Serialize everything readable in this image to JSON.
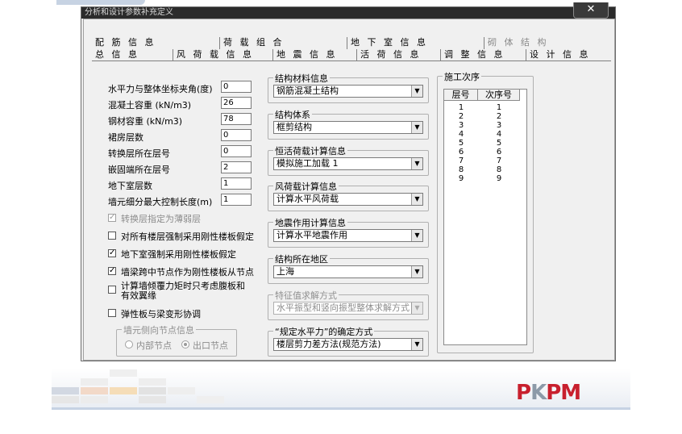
{
  "window": {
    "title": "分析和设计参数补充定义",
    "close_glyph": "✕"
  },
  "tabs": {
    "row1": [
      {
        "label": "配 筋 信 息",
        "enabled": true
      },
      {
        "label": "荷 载 组 合",
        "enabled": true
      },
      {
        "label": "地 下 室 信 息",
        "enabled": true
      },
      {
        "label": "砌 体 结 构",
        "enabled": false
      }
    ],
    "row2": [
      {
        "label": "总 信 息",
        "active": true
      },
      {
        "label": "风 荷 载 信 息"
      },
      {
        "label": "地 震 信 息"
      },
      {
        "label": "活 荷 信 息"
      },
      {
        "label": "调 整 信 息"
      },
      {
        "label": "设 计 信 息"
      }
    ]
  },
  "fields": [
    {
      "label": "水平力与整体坐标夹角(度)",
      "value": "0"
    },
    {
      "label": "混凝土容重  (kN/m3)",
      "value": "26"
    },
    {
      "label": "钢材容重     (kN/m3)",
      "value": "78"
    },
    {
      "label": "裙房层数",
      "value": "0"
    },
    {
      "label": "转换层所在层号",
      "value": "0"
    },
    {
      "label": "嵌固端所在层号",
      "value": "2"
    },
    {
      "label": "地下室层数",
      "value": "1"
    },
    {
      "label": "墙元细分最大控制长度(m)",
      "value": "1"
    }
  ],
  "checkboxes": [
    {
      "label": "转换层指定为薄弱层",
      "checked": true,
      "enabled": false
    },
    {
      "label": "对所有楼层强制采用刚性楼板假定",
      "checked": false,
      "enabled": true
    },
    {
      "label": "地下室强制采用刚性楼板假定",
      "checked": true,
      "enabled": true
    },
    {
      "label": "墙梁跨中节点作为刚性楼板从节点",
      "checked": true,
      "enabled": true
    },
    {
      "label": "计算墙倾覆力矩时只考虑腹板和",
      "label2": "有效翼缘",
      "checked": false,
      "enabled": true
    },
    {
      "label": "弹性板与梁变形协调",
      "checked": false,
      "enabled": true
    }
  ],
  "wall_node_group": {
    "title": "墙元侧向节点信息",
    "options": [
      "内部节点",
      "出口节点"
    ],
    "selected": "出口节点"
  },
  "dropdown_groups": [
    {
      "title": "结构材料信息",
      "value": "钢筋混凝土结构",
      "enabled": true
    },
    {
      "title": "结构体系",
      "value": "框剪结构",
      "enabled": true
    },
    {
      "title": "恒活荷载计算信息",
      "value": "模拟施工加载  1",
      "enabled": true
    },
    {
      "title": "风荷载计算信息",
      "value": "计算水平风荷载",
      "enabled": true
    },
    {
      "title": "地震作用计算信息",
      "value": "计算水平地震作用",
      "enabled": true
    },
    {
      "title": "结构所在地区",
      "value": "上海",
      "enabled": true
    },
    {
      "title": "特征值求解方式",
      "value": "水平振型和竖向振型整体求解方式",
      "enabled": false
    },
    {
      "title": "“规定水平力”的确定方式",
      "value": "楼层剪力差方法(规范方法)",
      "enabled": true
    }
  ],
  "construction_sequence": {
    "title": "施工次序",
    "headers": [
      "层号",
      "次序号"
    ],
    "rows": [
      [
        "1",
        "1"
      ],
      [
        "2",
        "2"
      ],
      [
        "3",
        "3"
      ],
      [
        "4",
        "4"
      ],
      [
        "5",
        "5"
      ],
      [
        "6",
        "6"
      ],
      [
        "7",
        "7"
      ],
      [
        "8",
        "8"
      ],
      [
        "9",
        "9"
      ]
    ]
  },
  "footer": {
    "logo_text_1": "P",
    "logo_text_2": "K",
    "logo_text_3": "PM",
    "colors": {
      "logo_red": "#c8202e",
      "logo_grey": "#8c9aa8",
      "band_blue": "#c6d2e3"
    }
  }
}
